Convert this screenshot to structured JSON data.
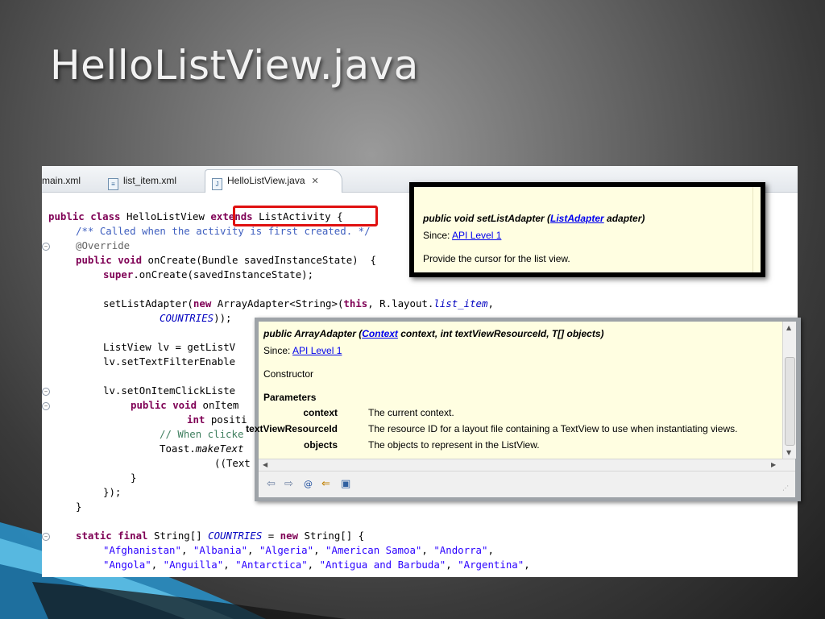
{
  "slide": {
    "title": "HelloListView.java"
  },
  "tabs": [
    {
      "label": "main.xml"
    },
    {
      "label": "list_item.xml"
    },
    {
      "label": "HelloListView.java",
      "close": "✕"
    }
  ],
  "code": {
    "l1a": "public class ",
    "l1b": "HelloListView ",
    "l1c": "extends",
    "l1d": " ListActivity",
    "l1e": " {",
    "l2": "/** Called when the activity is first created. */",
    "l3": "@Override",
    "l4a": "public void",
    "l4b": " onCreate(Bundle savedInstanceState)  {",
    "l5a": "super",
    "l5b": ".onCreate(savedInstanceState);",
    "l6a": "setListAdapter(",
    "l6b": "new",
    "l6c": " ArrayAdapter<String>(",
    "l6d": "this",
    "l6e": ", R.layout.",
    "l6f": "list_item",
    "l6g": ",",
    "l7a": "COUNTRIES",
    "l7b": "));",
    "l8": "ListView lv = getListV",
    "l9": "lv.setTextFilterEnable",
    "l10": "lv.setOnItemClickListe",
    "l11a": "public void",
    "l11b": " onItem",
    "l12a": "int",
    "l12b": " positi",
    "l13": "// When clicke",
    "l14a": "Toast.",
    "l14b": "makeText",
    "l15": "((Text",
    "l16": "}",
    "l17": "});",
    "l18": "}",
    "l19a": "static final",
    "l19b": " String[] ",
    "l19c": "COUNTRIES",
    "l19d": " = ",
    "l19e": "new",
    "l19f": " String[] {",
    "l20a": "\"Afghanistan\"",
    "l20b": ", ",
    "l20c": "\"Albania\"",
    "l20d": ", ",
    "l20e": "\"Algeria\"",
    "l20f": ", ",
    "l20g": "\"American Samoa\"",
    "l20h": ", ",
    "l20i": "\"Andorra\"",
    "l20j": ",",
    "l21a": "\"Angola\"",
    "l21b": ", ",
    "l21c": "\"Anguilla\"",
    "l21d": ", ",
    "l21e": "\"Antarctica\"",
    "l21f": ", ",
    "l21g": "\"Antigua and Barbuda\"",
    "l21h": ", ",
    "l21i": "\"Argentina\"",
    "l21j": ","
  },
  "tooltip1": {
    "sig_prefix": "public void setListAdapter (",
    "sig_link": "ListAdapter",
    "sig_suffix": " adapter)",
    "since_label": "Since: ",
    "since_link": "API Level 1",
    "description": "Provide the cursor for the list view."
  },
  "tooltip2": {
    "sig_prefix": "public ArrayAdapter (",
    "sig_link": "Context",
    "sig_suffix": " context, int textViewResourceId, T[] objects)",
    "since_label": "Since: ",
    "since_link": "API Level 1",
    "kind": "Constructor",
    "params_header": "Parameters",
    "params": [
      {
        "name": "context",
        "desc": "The current context."
      },
      {
        "name": "textViewResourceId",
        "desc": "The resource ID for a layout file containing a TextView to use when instantiating views."
      },
      {
        "name": "objects",
        "desc": "The objects to represent in the ListView."
      }
    ],
    "toolbar": {
      "back": "⇦",
      "forward": "⇨",
      "at": "@",
      "open": "⇐",
      "external": "▣"
    }
  },
  "colors": {
    "keyword": "#7f0055",
    "comment": "#3f5fbf",
    "string": "#2a00ff",
    "field": "#0000c0",
    "highlight": "#e01010",
    "tooltip_bg": "#fffee1"
  }
}
